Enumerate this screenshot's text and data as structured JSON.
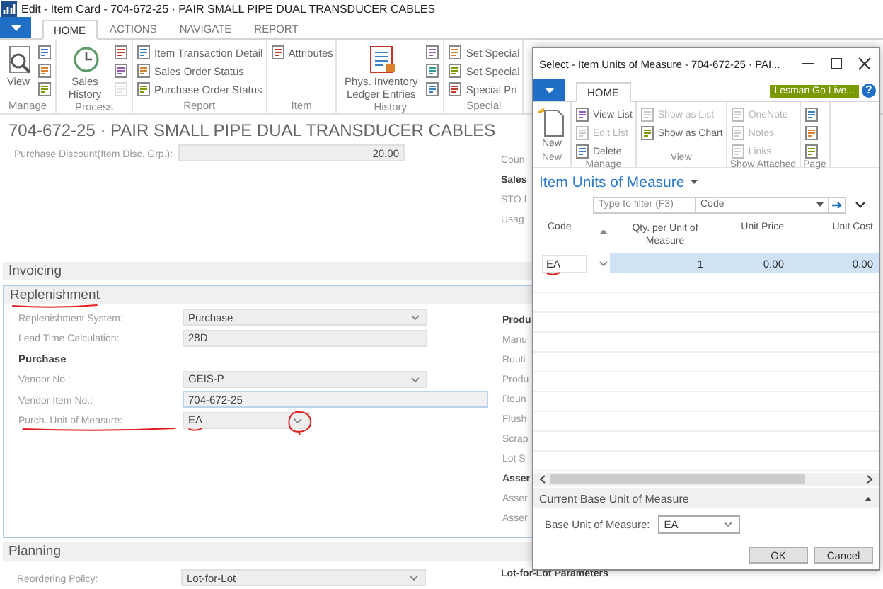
{
  "window": {
    "title": "Edit - Item Card - 704-672-25 · PAIR SMALL PIPE DUAL TRANSDUCER CABLES"
  },
  "tabs": [
    {
      "label": "HOME",
      "selected": true
    },
    {
      "label": "ACTIONS",
      "selected": false
    },
    {
      "label": "NAVIGATE",
      "selected": false
    },
    {
      "label": "REPORT",
      "selected": false
    }
  ],
  "ribbon": [
    {
      "label": "Manage",
      "items": [
        {
          "kind": "large",
          "label": "View"
        },
        {
          "kind": "icon",
          "disabled": false
        },
        {
          "kind": "icon",
          "disabled": false
        },
        {
          "kind": "icon",
          "disabled": false
        }
      ]
    },
    {
      "label": "Process",
      "items": [
        {
          "kind": "large",
          "label": "Sales History"
        },
        {
          "kind": "icon",
          "disabled": false
        },
        {
          "kind": "icon",
          "disabled": false
        },
        {
          "kind": "icon",
          "disabled": true
        }
      ]
    },
    {
      "label": "Report",
      "items": [
        {
          "kind": "small",
          "label": "Item Transaction Detail",
          "disabled": false
        },
        {
          "kind": "small",
          "label": "Sales Order Status",
          "disabled": false
        },
        {
          "kind": "small",
          "label": "Purchase Order Status",
          "disabled": false
        }
      ]
    },
    {
      "label": "Item",
      "items": [
        {
          "kind": "small",
          "label": "Attributes",
          "disabled": false
        }
      ]
    },
    {
      "label": "History",
      "items": [
        {
          "kind": "large",
          "label": "Phys. Inventory Ledger Entries"
        },
        {
          "kind": "icon",
          "disabled": false
        },
        {
          "kind": "icon",
          "disabled": false
        },
        {
          "kind": "icon",
          "disabled": false
        }
      ]
    },
    {
      "label": "Special",
      "items": [
        {
          "kind": "small",
          "label": "Set Special",
          "disabled": false
        },
        {
          "kind": "small",
          "label": "Set Special",
          "disabled": false
        },
        {
          "kind": "small",
          "label": "Special Pri",
          "disabled": false
        }
      ]
    }
  ],
  "page_title": "704-672-25 · PAIR SMALL PIPE DUAL TRANSDUCER CABLES",
  "general": {
    "fields": [
      {
        "kind": "number",
        "label": "Purchase Discount(Item Disc. Grp.):",
        "value": "20.00"
      }
    ],
    "side": [
      {
        "kind": "label",
        "text": "Coun"
      },
      {
        "kind": "heading",
        "text": "Sales"
      },
      {
        "kind": "label",
        "text": "STO I"
      },
      {
        "kind": "label",
        "text": "Usag"
      }
    ]
  },
  "sections": [
    {
      "title": "Invoicing",
      "focused": false,
      "underlined": false
    },
    {
      "title": "Replenishment",
      "focused": true,
      "underlined": true,
      "fields": [
        {
          "kind": "dropdown",
          "label": "Replenishment System:",
          "value": "Purchase"
        },
        {
          "kind": "text",
          "label": "Lead Time Calculation:",
          "value": "28D"
        },
        {
          "kind": "heading",
          "label": "Purchase"
        },
        {
          "kind": "dropdown",
          "label": "Vendor No.:",
          "value": "GEIS-P"
        },
        {
          "kind": "editable",
          "label": "Vendor Item No.:",
          "value": "704-672-25"
        },
        {
          "kind": "short_dropdown",
          "label": "Purch. Unit of Measure:",
          "value": "EA",
          "underlined": true,
          "circled": true
        }
      ],
      "side": [
        {
          "kind": "heading",
          "text": "Produ"
        },
        {
          "kind": "label",
          "text": "Manu"
        },
        {
          "kind": "label",
          "text": "Routi"
        },
        {
          "kind": "label",
          "text": "Produ"
        },
        {
          "kind": "label",
          "text": "Roun"
        },
        {
          "kind": "label",
          "text": "Flush"
        },
        {
          "kind": "label",
          "text": "Scrap"
        },
        {
          "kind": "label",
          "text": "Lot S"
        },
        {
          "kind": "heading",
          "text": "Asser"
        },
        {
          "kind": "label",
          "text": "Asser"
        },
        {
          "kind": "label",
          "text": "Asser"
        }
      ]
    },
    {
      "title": "Planning",
      "focused": false,
      "underlined": false,
      "fields": [
        {
          "kind": "dropdown",
          "label": "Reordering Policy:",
          "value": "Lot-for-Lot"
        }
      ],
      "side": [
        {
          "kind": "heading",
          "text": "Lot-for-Lot Parameters"
        }
      ]
    }
  ],
  "dialog": {
    "title": "Select - Item Units of Measure - 704-672-25 · PAI...",
    "tabs": [
      {
        "label": "HOME",
        "selected": true
      }
    ],
    "badge": "Lesman Go Live...",
    "help": "?",
    "ribbon": [
      {
        "label": "New",
        "items": [
          {
            "kind": "large",
            "label": "New"
          }
        ]
      },
      {
        "label": "Manage",
        "items": [
          {
            "kind": "small",
            "label": "View List",
            "disabled": false
          },
          {
            "kind": "small",
            "label": "Edit List",
            "disabled": true
          },
          {
            "kind": "small",
            "label": "Delete",
            "disabled": false
          }
        ]
      },
      {
        "label": "View",
        "items": [
          {
            "kind": "small",
            "label": "Show as List",
            "disabled": true
          },
          {
            "kind": "small",
            "label": "Show as Chart",
            "disabled": false
          }
        ]
      },
      {
        "label": "Show Attached",
        "items": [
          {
            "kind": "small",
            "label": "OneNote",
            "disabled": true
          },
          {
            "kind": "small",
            "label": "Notes",
            "disabled": true
          },
          {
            "kind": "small",
            "label": "Links",
            "disabled": true
          }
        ]
      },
      {
        "label": "Page",
        "items": [
          {
            "kind": "icon",
            "disabled": false
          },
          {
            "kind": "icon",
            "disabled": false
          },
          {
            "kind": "icon",
            "disabled": false
          }
        ]
      }
    ],
    "list_title": "Item Units of Measure",
    "filter": {
      "placeholder": "Type to filter (F3)",
      "field": "Code"
    },
    "columns": [
      "Code",
      "Qty. per Unit of Measure",
      "Unit Price",
      "Unit Cost"
    ],
    "rows": [
      {
        "cells": [
          "EA",
          "1",
          "0.00",
          "0.00"
        ],
        "selected": true,
        "underlined": true
      }
    ],
    "base_section": {
      "title": "Current Base Unit of Measure",
      "expanded": true,
      "label": "Base Unit of Measure:",
      "value": "EA"
    },
    "buttons": [
      "OK",
      "Cancel"
    ]
  }
}
